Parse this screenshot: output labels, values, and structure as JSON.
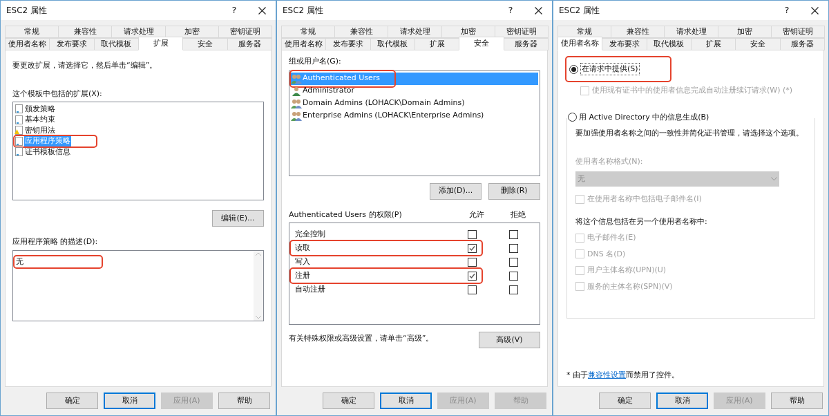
{
  "dialogs": [
    {
      "title": "ESC2 属性",
      "help": "?",
      "tab_rows": [
        [
          {
            "label": "常规",
            "selected": false
          },
          {
            "label": "兼容性",
            "selected": false
          },
          {
            "label": "请求处理",
            "selected": false
          },
          {
            "label": "加密",
            "selected": false
          },
          {
            "label": "密钥证明",
            "selected": false
          }
        ],
        [
          {
            "label": "使用者名称",
            "selected": false
          },
          {
            "label": "发布要求",
            "selected": false
          },
          {
            "label": "取代模板",
            "selected": false
          },
          {
            "label": "扩展",
            "selected": true
          },
          {
            "label": "安全",
            "selected": false
          },
          {
            "label": "服务器",
            "selected": false
          }
        ]
      ],
      "content": {
        "kind": "extensions",
        "instruction": "要更改扩展，请选择它，然后单击“编辑”。",
        "list_label": "这个模板中包括的扩展(X):",
        "items": [
          {
            "label": "颁发策略",
            "kind": "doc",
            "selected": false,
            "highlighted": false
          },
          {
            "label": "基本约束",
            "kind": "doc",
            "selected": false,
            "highlighted": false
          },
          {
            "label": "密钥用法",
            "kind": "warn",
            "selected": false,
            "highlighted": false
          },
          {
            "label": "应用程序策略",
            "kind": "doc",
            "selected": true,
            "highlighted": true
          },
          {
            "label": "证书模板信息",
            "kind": "doc",
            "selected": false,
            "highlighted": false
          }
        ],
        "edit_button": "编辑(E)...",
        "description_label": "应用程序策略 的描述(D):",
        "description": {
          "text": "无",
          "highlighted": true
        }
      },
      "buttons": [
        {
          "label": "确定",
          "disabled": false,
          "focused": false
        },
        {
          "label": "取消",
          "disabled": false,
          "focused": true
        },
        {
          "label": "应用(A)",
          "disabled": true,
          "focused": false
        },
        {
          "label": "帮助",
          "disabled": false,
          "focused": false
        }
      ]
    },
    {
      "title": "ESC2 属性",
      "help": "?",
      "tab_rows": [
        [
          {
            "label": "常规",
            "selected": false
          },
          {
            "label": "兼容性",
            "selected": false
          },
          {
            "label": "请求处理",
            "selected": false
          },
          {
            "label": "加密",
            "selected": false
          },
          {
            "label": "密钥证明",
            "selected": false
          }
        ],
        [
          {
            "label": "使用者名称",
            "selected": false
          },
          {
            "label": "发布要求",
            "selected": false
          },
          {
            "label": "取代模板",
            "selected": false
          },
          {
            "label": "扩展",
            "selected": false
          },
          {
            "label": "安全",
            "selected": true
          },
          {
            "label": "服务器",
            "selected": false
          }
        ]
      ],
      "content": {
        "kind": "security",
        "users_label": "组或用户名(G):",
        "users": [
          {
            "label": "Authenticated Users",
            "kind": "group",
            "selected": true,
            "highlighted": true
          },
          {
            "label": "Administrator",
            "kind": "user",
            "selected": false,
            "highlighted": false
          },
          {
            "label": "Domain Admins (LOHACK\\Domain Admins)",
            "kind": "group",
            "selected": false,
            "highlighted": false
          },
          {
            "label": "Enterprise Admins (LOHACK\\Enterprise Admins)",
            "kind": "group",
            "selected": false,
            "highlighted": false
          }
        ],
        "user_buttons": [
          "添加(D)...",
          "删除(R)"
        ],
        "permissions_label": "Authenticated Users 的权限(P)",
        "allow_label": "允许",
        "deny_label": "拒绝",
        "permissions": [
          {
            "label": "完全控制",
            "allow": false,
            "deny": false,
            "highlighted": false
          },
          {
            "label": "读取",
            "allow": true,
            "deny": false,
            "highlighted": true
          },
          {
            "label": "写入",
            "allow": false,
            "deny": false,
            "highlighted": false
          },
          {
            "label": "注册",
            "allow": true,
            "deny": false,
            "highlighted": true
          },
          {
            "label": "自动注册",
            "allow": false,
            "deny": false,
            "highlighted": false
          }
        ],
        "advanced_note": "有关特殊权限或高级设置，请单击“高级”。",
        "advanced_button": "高级(V)"
      },
      "buttons": [
        {
          "label": "确定",
          "disabled": false,
          "focused": false
        },
        {
          "label": "取消",
          "disabled": false,
          "focused": true
        },
        {
          "label": "应用(A)",
          "disabled": true,
          "focused": false
        },
        {
          "label": "帮助",
          "disabled": true,
          "focused": false
        }
      ]
    },
    {
      "title": "ESC2 属性",
      "help": "?",
      "tab_rows": [
        [
          {
            "label": "常规",
            "selected": false
          },
          {
            "label": "兼容性",
            "selected": false
          },
          {
            "label": "请求处理",
            "selected": false
          },
          {
            "label": "加密",
            "selected": false
          },
          {
            "label": "密钥证明",
            "selected": false
          }
        ],
        [
          {
            "label": "使用者名称",
            "selected": true
          },
          {
            "label": "发布要求",
            "selected": false
          },
          {
            "label": "取代模板",
            "selected": false
          },
          {
            "label": "扩展",
            "selected": false
          },
          {
            "label": "安全",
            "selected": false
          },
          {
            "label": "服务器",
            "selected": false
          }
        ]
      ],
      "content": {
        "kind": "subject_name",
        "supply_radio": {
          "label": "在请求中提供(S)",
          "selected": true,
          "highlighted": true
        },
        "renewal_checkbox": {
          "label": "使用现有证书中的使用者信息完成自动注册续订请求(W) (*)",
          "checked": false,
          "disabled": true
        },
        "build_radio": {
          "label": "用 Active Directory 中的信息生成(B)",
          "selected": false
        },
        "build_description": "要加强使用者名称之间的一致性并简化证书管理，请选择这个选项。",
        "format_label": "使用者名称格式(N):",
        "format_value": "无",
        "email_checkbox": {
          "label": "在使用者名称中包括电子邮件名(I)",
          "checked": false,
          "disabled": true
        },
        "alt_label": "将这个信息包括在另一个使用者名称中:",
        "alt_checkboxes": [
          {
            "label": "电子邮件名(E)",
            "checked": false,
            "disabled": true
          },
          {
            "label": "DNS 名(D)",
            "checked": false,
            "disabled": true
          },
          {
            "label": "用户主体名称(UPN)(U)",
            "checked": false,
            "disabled": true
          },
          {
            "label": "服务的主体名称(SPN)(V)",
            "checked": false,
            "disabled": true
          }
        ],
        "footnote_prefix": "* 由于",
        "footnote_link": "兼容性设置",
        "footnote_suffix": "而禁用了控件。"
      },
      "buttons": [
        {
          "label": "确定",
          "disabled": false,
          "focused": false
        },
        {
          "label": "取消",
          "disabled": false,
          "focused": true
        },
        {
          "label": "应用(A)",
          "disabled": true,
          "focused": false
        },
        {
          "label": "帮助",
          "disabled": false,
          "focused": false
        }
      ]
    }
  ]
}
